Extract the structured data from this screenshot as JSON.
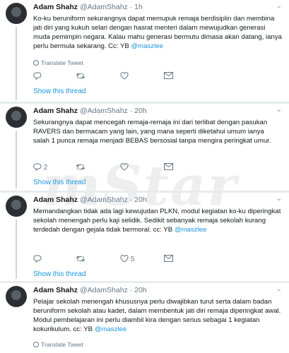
{
  "tweets": [
    {
      "name": "Adam Shahz",
      "handle": "@AdamShahz",
      "time": "1h",
      "text": "Ko-ku beruniform sekurangnya dapat memupuk remaja berdisiplin dan membina jati diri yang kukuh selari dengan hasrat menteri dalam mewujudkan generasi muda pemimpin negara. Kalau mahu generasi bermutu dimasa akan datang, ianya perlu bermula sekarang. Cc: YB ",
      "mention": "@maszlee",
      "translate": "Translate Tweet",
      "reply_count": "",
      "retweet_count": "",
      "like_count": "",
      "show_thread": "Show this thread"
    },
    {
      "name": "Adam Shahz",
      "handle": "@AdamShahz",
      "time": "20h",
      "text": "Sekurangnya dapat mencegah remaja-remaja ini dari terlibat dengan pasukan RAVERS dan bermacam yang lain, yang mana seperti diketahui umum ianya salah 1 punca remaja menjadi BEBAS bersosial tanpa mengira peringkat umur.",
      "mention": "",
      "translate": "",
      "reply_count": "2",
      "retweet_count": "",
      "like_count": "",
      "show_thread": "Show this thread"
    },
    {
      "name": "Adam Shahz",
      "handle": "@AdamShahz",
      "time": "20h",
      "text": "Memandangkan tidak ada lagi kewujudan PLKN, modul kegiatan ko-ku diperingkat sekolah menengah perlu kaji selidik. Sedikit sebanyak remaja sekolah kurang terdedah dengan gejala tidak bermoral. cc: YB ",
      "mention": "@maszlee",
      "translate": "",
      "reply_count": "",
      "retweet_count": "",
      "like_count": "5",
      "show_thread": "Show this thread"
    },
    {
      "name": "Adam Shahz",
      "handle": "@AdamShahz",
      "time": "20h",
      "text": "Pelajar sekolah menengah khususnya perlu diwajibkan turut serta dalam badan beruniform sekolah atau kadet, dalam membentuk jati diri remaja diperingkat awal. Modul pembelajaran ini perlu diambil kira dengan serius sebagai 1 kegiatan kokurikulum. cc: YB ",
      "mention": "@maszlee",
      "translate": "Translate Tweet",
      "reply_count": "",
      "retweet_count": "",
      "like_count": "",
      "show_thread": ""
    }
  ],
  "watermark": "mStar",
  "colors": {
    "link": "#1b95e0",
    "muted": "#657786",
    "text": "#14171a",
    "separator": "#e6ecf0"
  }
}
